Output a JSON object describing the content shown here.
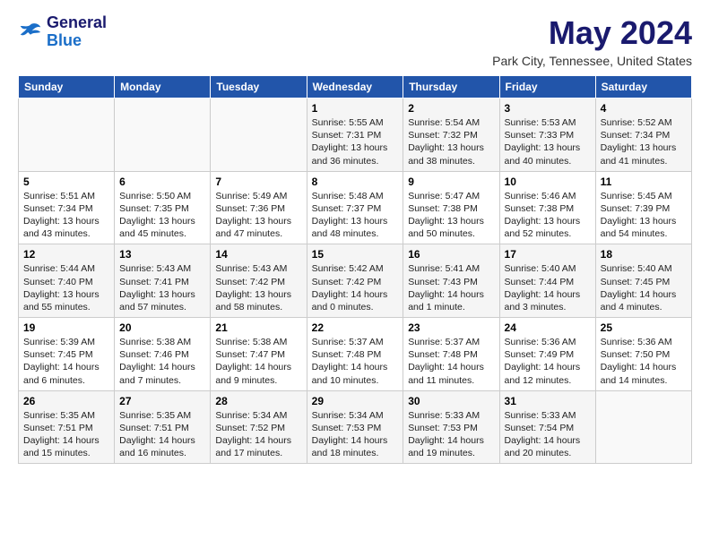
{
  "logo": {
    "line1": "General",
    "line2": "Blue"
  },
  "title": "May 2024",
  "location": "Park City, Tennessee, United States",
  "headers": [
    "Sunday",
    "Monday",
    "Tuesday",
    "Wednesday",
    "Thursday",
    "Friday",
    "Saturday"
  ],
  "weeks": [
    [
      {
        "day": "",
        "content": ""
      },
      {
        "day": "",
        "content": ""
      },
      {
        "day": "",
        "content": ""
      },
      {
        "day": "1",
        "content": "Sunrise: 5:55 AM\nSunset: 7:31 PM\nDaylight: 13 hours and 36 minutes."
      },
      {
        "day": "2",
        "content": "Sunrise: 5:54 AM\nSunset: 7:32 PM\nDaylight: 13 hours and 38 minutes."
      },
      {
        "day": "3",
        "content": "Sunrise: 5:53 AM\nSunset: 7:33 PM\nDaylight: 13 hours and 40 minutes."
      },
      {
        "day": "4",
        "content": "Sunrise: 5:52 AM\nSunset: 7:34 PM\nDaylight: 13 hours and 41 minutes."
      }
    ],
    [
      {
        "day": "5",
        "content": "Sunrise: 5:51 AM\nSunset: 7:34 PM\nDaylight: 13 hours and 43 minutes."
      },
      {
        "day": "6",
        "content": "Sunrise: 5:50 AM\nSunset: 7:35 PM\nDaylight: 13 hours and 45 minutes."
      },
      {
        "day": "7",
        "content": "Sunrise: 5:49 AM\nSunset: 7:36 PM\nDaylight: 13 hours and 47 minutes."
      },
      {
        "day": "8",
        "content": "Sunrise: 5:48 AM\nSunset: 7:37 PM\nDaylight: 13 hours and 48 minutes."
      },
      {
        "day": "9",
        "content": "Sunrise: 5:47 AM\nSunset: 7:38 PM\nDaylight: 13 hours and 50 minutes."
      },
      {
        "day": "10",
        "content": "Sunrise: 5:46 AM\nSunset: 7:38 PM\nDaylight: 13 hours and 52 minutes."
      },
      {
        "day": "11",
        "content": "Sunrise: 5:45 AM\nSunset: 7:39 PM\nDaylight: 13 hours and 54 minutes."
      }
    ],
    [
      {
        "day": "12",
        "content": "Sunrise: 5:44 AM\nSunset: 7:40 PM\nDaylight: 13 hours and 55 minutes."
      },
      {
        "day": "13",
        "content": "Sunrise: 5:43 AM\nSunset: 7:41 PM\nDaylight: 13 hours and 57 minutes."
      },
      {
        "day": "14",
        "content": "Sunrise: 5:43 AM\nSunset: 7:42 PM\nDaylight: 13 hours and 58 minutes."
      },
      {
        "day": "15",
        "content": "Sunrise: 5:42 AM\nSunset: 7:42 PM\nDaylight: 14 hours and 0 minutes."
      },
      {
        "day": "16",
        "content": "Sunrise: 5:41 AM\nSunset: 7:43 PM\nDaylight: 14 hours and 1 minute."
      },
      {
        "day": "17",
        "content": "Sunrise: 5:40 AM\nSunset: 7:44 PM\nDaylight: 14 hours and 3 minutes."
      },
      {
        "day": "18",
        "content": "Sunrise: 5:40 AM\nSunset: 7:45 PM\nDaylight: 14 hours and 4 minutes."
      }
    ],
    [
      {
        "day": "19",
        "content": "Sunrise: 5:39 AM\nSunset: 7:45 PM\nDaylight: 14 hours and 6 minutes."
      },
      {
        "day": "20",
        "content": "Sunrise: 5:38 AM\nSunset: 7:46 PM\nDaylight: 14 hours and 7 minutes."
      },
      {
        "day": "21",
        "content": "Sunrise: 5:38 AM\nSunset: 7:47 PM\nDaylight: 14 hours and 9 minutes."
      },
      {
        "day": "22",
        "content": "Sunrise: 5:37 AM\nSunset: 7:48 PM\nDaylight: 14 hours and 10 minutes."
      },
      {
        "day": "23",
        "content": "Sunrise: 5:37 AM\nSunset: 7:48 PM\nDaylight: 14 hours and 11 minutes."
      },
      {
        "day": "24",
        "content": "Sunrise: 5:36 AM\nSunset: 7:49 PM\nDaylight: 14 hours and 12 minutes."
      },
      {
        "day": "25",
        "content": "Sunrise: 5:36 AM\nSunset: 7:50 PM\nDaylight: 14 hours and 14 minutes."
      }
    ],
    [
      {
        "day": "26",
        "content": "Sunrise: 5:35 AM\nSunset: 7:51 PM\nDaylight: 14 hours and 15 minutes."
      },
      {
        "day": "27",
        "content": "Sunrise: 5:35 AM\nSunset: 7:51 PM\nDaylight: 14 hours and 16 minutes."
      },
      {
        "day": "28",
        "content": "Sunrise: 5:34 AM\nSunset: 7:52 PM\nDaylight: 14 hours and 17 minutes."
      },
      {
        "day": "29",
        "content": "Sunrise: 5:34 AM\nSunset: 7:53 PM\nDaylight: 14 hours and 18 minutes."
      },
      {
        "day": "30",
        "content": "Sunrise: 5:33 AM\nSunset: 7:53 PM\nDaylight: 14 hours and 19 minutes."
      },
      {
        "day": "31",
        "content": "Sunrise: 5:33 AM\nSunset: 7:54 PM\nDaylight: 14 hours and 20 minutes."
      },
      {
        "day": "",
        "content": ""
      }
    ]
  ]
}
